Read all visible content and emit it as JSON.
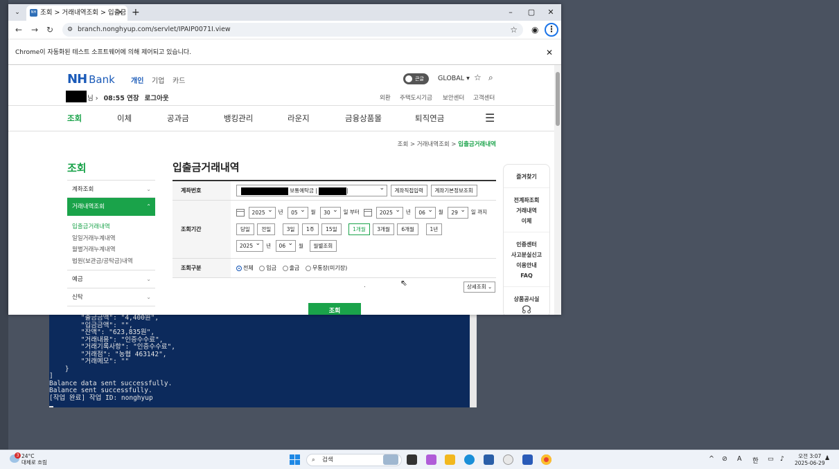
{
  "browser": {
    "tab_title": "조회 > 거래내역조회 > 입출금",
    "tab_favicon": "NH",
    "url": "branch.nonghyup.com/servlet/IPAIP0071I.view",
    "automation_notice": "Chrome이 자동화된 테스트 소프트웨어에 의해 제어되고 있습니다.",
    "window_controls": {
      "minimize": "–",
      "maximize": "▢",
      "close": "✕"
    }
  },
  "site": {
    "logo_nh": "NH",
    "logo_bank": "Bank",
    "top_links": [
      "개인",
      "기업",
      "카드"
    ],
    "toggle_label": "큰글",
    "global_label": "GLOBAL ▾",
    "user_suffix": "님 ›",
    "session_time": "08:55 연장",
    "logout": "로그아웃",
    "util_links": [
      "외환",
      "주택도시기금",
      "보안센터",
      "고객센터"
    ],
    "gnb": [
      "조회",
      "이체",
      "공과금",
      "뱅킹관리",
      "라운지",
      "금융상품몰",
      "퇴직연금"
    ],
    "breadcrumb": {
      "path": "조회 > 거래내역조회 > ",
      "current": "입출금거래내역"
    }
  },
  "lnb": {
    "title": "조회",
    "items": [
      {
        "label": "계좌조회",
        "chev": "⌄"
      },
      {
        "label": "거래내역조회",
        "chev": "⌃"
      }
    ],
    "subs": [
      "입출금거래내역",
      "일일거래누계내역",
      "월별거래누계내역",
      "법원(보관금/공탁금)내역"
    ],
    "after": [
      {
        "label": "예금",
        "chev": "⌄"
      },
      {
        "label": "신탁",
        "chev": "⌄"
      }
    ]
  },
  "content": {
    "title": "입출금거래내역",
    "account_label": "계좌번호",
    "account_type": "보통예탁금 |",
    "account_tail": "|",
    "acct_btn1": "계좌직접입력",
    "acct_btn2": "계좌기본정보조회",
    "period_label": "조회기간",
    "from": {
      "year": "2025",
      "month": "05",
      "day": "30"
    },
    "to": {
      "year": "2025",
      "month": "06",
      "day": "29"
    },
    "unit_year": "년",
    "unit_month": "월",
    "unit_day": "일",
    "from_suffix": "일 부터",
    "to_suffix": "일 까지",
    "quick": [
      "당일",
      "전일",
      "3일",
      "1주",
      "15일",
      "1개월",
      "3개월",
      "6개월",
      "1년"
    ],
    "quick_active": "1개월",
    "month_year": "2025",
    "month_month": "06",
    "monthly_btn": "월별조회",
    "kind_label": "조회구분",
    "kinds": [
      "전체",
      "입금",
      "출금",
      "무통장(미기장)"
    ],
    "kind_selected": "전체",
    "detail_btn": "상세조회 ⌄",
    "search_btn": "조회"
  },
  "right_side": {
    "heading": "즐겨찾기",
    "group1": [
      "전계좌조회",
      "거래내역",
      "이체"
    ],
    "group2": [
      "인증센터",
      "사고분실신고",
      "이용안내",
      "FAQ"
    ],
    "group3": [
      "상품공시실"
    ],
    "headset_icon": "headset-icon"
  },
  "console": {
    "lines": [
      "        \"출금금액\": \"4,400원\",",
      "        \"입금금액\": \"\",",
      "        \"잔액\": \"623,835원\",",
      "        \"거래내용\": \"인증수수료\",",
      "        \"거래기록사항\": \"인증수수료\",",
      "        \"거래점\": \"농협 463142\",",
      "        \"거래메모\": \"\"",
      "    }",
      "]",
      "Balance data sent successfully.",
      "Balance sent successfully.",
      "[작업 완료] 작업 ID: nonghyup"
    ]
  },
  "taskbar": {
    "temp": "24°C",
    "weather": "대체로 흐림",
    "badge": "3",
    "search_placeholder": "검색",
    "tray_chars": [
      "^",
      "A",
      "한"
    ],
    "time": "오전 3:07",
    "date": "2025-06-29"
  },
  "colors": {
    "nh_green": "#1aa34a",
    "nh_blue": "#1a5ab8"
  }
}
